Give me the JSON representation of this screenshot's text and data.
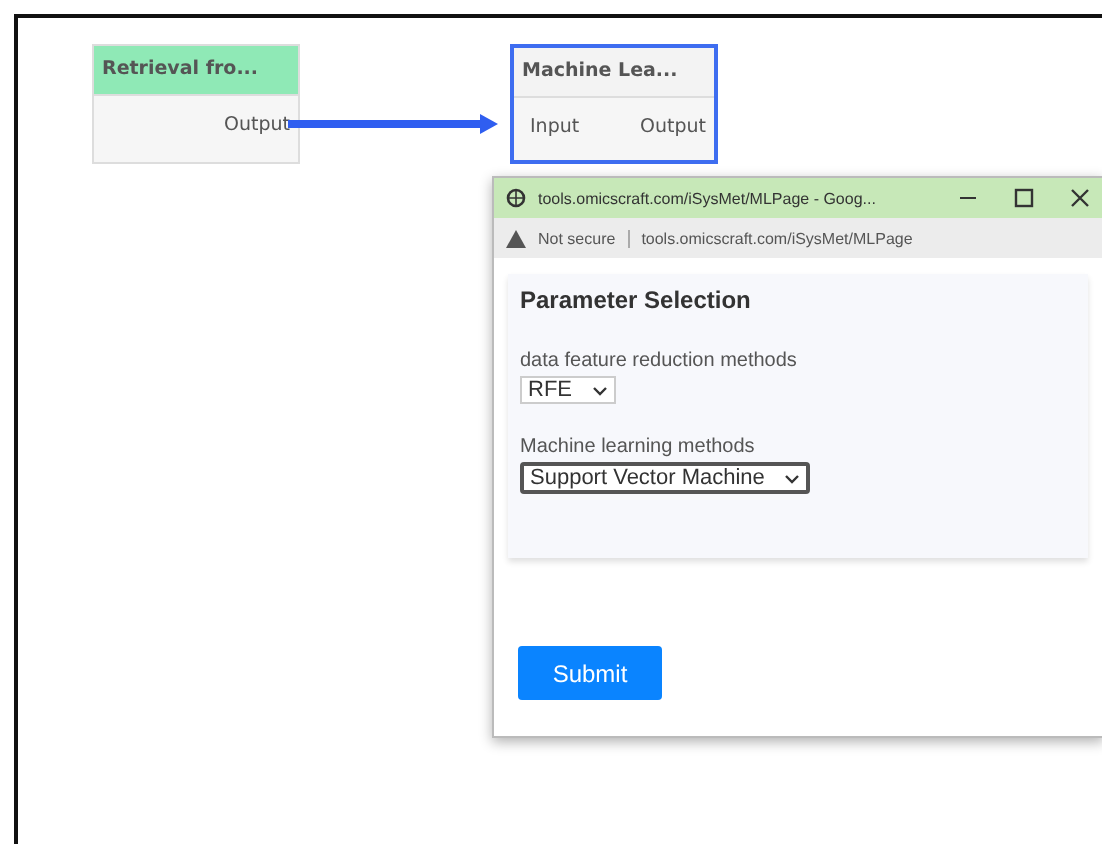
{
  "nodes": [
    {
      "title": "Retrieval fro...",
      "ports": [
        "Output"
      ],
      "selected": false,
      "kind": "source"
    },
    {
      "title": "Machine Lea...",
      "ports": [
        "Input",
        "Output"
      ],
      "selected": true,
      "kind": "process"
    }
  ],
  "popup": {
    "title": "tools.omicscraft.com/iSysMet/MLPage - Goog...",
    "security": "Not secure",
    "url": "tools.omicscraft.com/iSysMet/MLPage",
    "heading": "Parameter Selection",
    "fields": [
      {
        "label": "data feature reduction methods",
        "value": "RFE",
        "focused": false
      },
      {
        "label": "Machine learning methods",
        "value": "Support Vector Machine",
        "focused": true
      }
    ],
    "submit": "Submit"
  }
}
